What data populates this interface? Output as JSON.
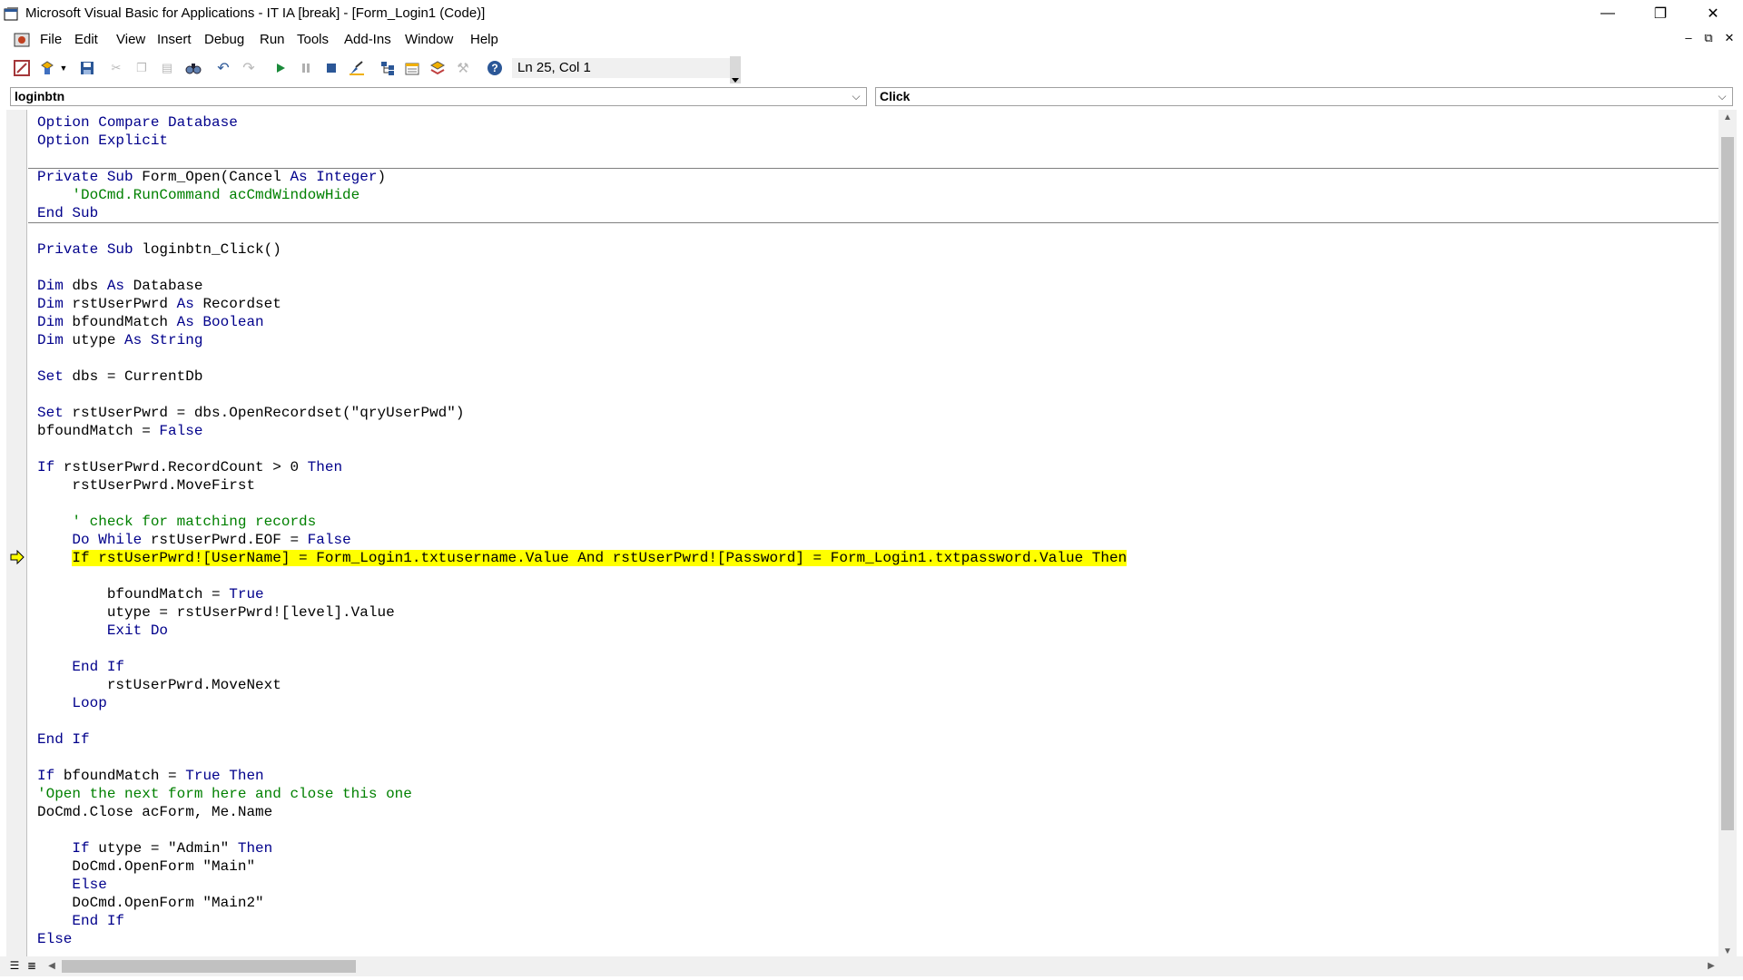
{
  "window": {
    "title": "Microsoft Visual Basic for Applications - IT IA [break] - [Form_Login1 (Code)]",
    "minimize_glyph": "—",
    "restore_glyph": "❐",
    "close_glyph": "✕"
  },
  "menu": {
    "items": [
      {
        "label": "File"
      },
      {
        "label": "Edit"
      },
      {
        "label": "View"
      },
      {
        "label": "Insert"
      },
      {
        "label": "Debug"
      },
      {
        "label": "Run"
      },
      {
        "label": "Tools"
      },
      {
        "label": "Add-Ins"
      },
      {
        "label": "Window"
      },
      {
        "label": "Help"
      }
    ],
    "mdi_min": "–",
    "mdi_restore": "⧉",
    "mdi_close": "✕"
  },
  "toolbar": {
    "status": "Ln 25, Col 1",
    "icons": [
      "view-access-icon",
      "insert-userform-icon",
      "save-icon",
      "cut-icon",
      "copy-icon",
      "paste-icon",
      "find-icon",
      "undo-icon",
      "redo-icon",
      "run-icon",
      "break-icon",
      "reset-icon",
      "design-mode-icon",
      "project-explorer-icon",
      "properties-window-icon",
      "object-browser-icon",
      "toolbox-icon",
      "help-icon"
    ]
  },
  "object_combo": {
    "value": "loginbtn"
  },
  "procedure_combo": {
    "value": "Click"
  },
  "code": {
    "current_line_index": 24,
    "separator_after_lines": [
      2,
      5
    ],
    "lines": [
      [
        [
          "kw",
          "Option Compare Database"
        ]
      ],
      [
        [
          "kw",
          "Option Explicit"
        ]
      ],
      [
        [
          "",
          ""
        ]
      ],
      [
        [
          "kw",
          "Private Sub "
        ],
        [
          "",
          "Form_Open("
        ],
        [
          "",
          "Cancel "
        ],
        [
          "kw",
          "As Integer"
        ],
        [
          "",
          ")"
        ]
      ],
      [
        [
          "",
          "    "
        ],
        [
          "cm",
          "'DoCmd.RunCommand acCmdWindowHide"
        ]
      ],
      [
        [
          "kw",
          "End Sub"
        ]
      ],
      [
        [
          "",
          ""
        ]
      ],
      [
        [
          "kw",
          "Private Sub "
        ],
        [
          "",
          "loginbtn_Click()"
        ]
      ],
      [
        [
          "",
          ""
        ]
      ],
      [
        [
          "kw",
          "Dim "
        ],
        [
          "",
          "dbs "
        ],
        [
          "kw",
          "As "
        ],
        [
          "",
          "Database"
        ]
      ],
      [
        [
          "kw",
          "Dim "
        ],
        [
          "",
          "rstUserPwrd "
        ],
        [
          "kw",
          "As "
        ],
        [
          "",
          "Recordset"
        ]
      ],
      [
        [
          "kw",
          "Dim "
        ],
        [
          "",
          "bfoundMatch "
        ],
        [
          "kw",
          "As Boolean"
        ]
      ],
      [
        [
          "kw",
          "Dim "
        ],
        [
          "",
          "utype "
        ],
        [
          "kw",
          "As String"
        ]
      ],
      [
        [
          "",
          ""
        ]
      ],
      [
        [
          "kw",
          "Set "
        ],
        [
          "",
          "dbs = CurrentDb"
        ]
      ],
      [
        [
          "",
          ""
        ]
      ],
      [
        [
          "kw",
          "Set "
        ],
        [
          "",
          "rstUserPwrd = dbs.OpenRecordset(\"qryUserPwd\")"
        ]
      ],
      [
        [
          "",
          "bfoundMatch = "
        ],
        [
          "kw",
          "False"
        ]
      ],
      [
        [
          "",
          ""
        ]
      ],
      [
        [
          "kw",
          "If "
        ],
        [
          "",
          "rstUserPwrd.RecordCount > 0 "
        ],
        [
          "kw",
          "Then"
        ]
      ],
      [
        [
          "",
          "    rstUserPwrd.MoveFirst"
        ]
      ],
      [
        [
          "",
          ""
        ]
      ],
      [
        [
          "",
          "    "
        ],
        [
          "cm",
          "' check for matching records"
        ]
      ],
      [
        [
          "",
          "    "
        ],
        [
          "kw",
          "Do While "
        ],
        [
          "",
          "rstUserPwrd.EOF = "
        ],
        [
          "kw",
          "False"
        ]
      ],
      [
        [
          "",
          "    "
        ],
        [
          "hl",
          "If rstUserPwrd![UserName] = Form_Login1.txtusername.Value And rstUserPwrd![Password] = Form_Login1.txtpassword.Value Then"
        ]
      ],
      [
        [
          "",
          ""
        ]
      ],
      [
        [
          "",
          "        bfoundMatch = "
        ],
        [
          "kw",
          "True"
        ]
      ],
      [
        [
          "",
          "        utype = rstUserPwrd![level].Value"
        ]
      ],
      [
        [
          "",
          "        "
        ],
        [
          "kw",
          "Exit Do"
        ]
      ],
      [
        [
          "",
          ""
        ]
      ],
      [
        [
          "",
          "    "
        ],
        [
          "kw",
          "End If"
        ]
      ],
      [
        [
          "",
          "        rstUserPwrd.MoveNext"
        ]
      ],
      [
        [
          "",
          "    "
        ],
        [
          "kw",
          "Loop"
        ]
      ],
      [
        [
          "",
          ""
        ]
      ],
      [
        [
          "kw",
          "End If"
        ]
      ],
      [
        [
          "",
          ""
        ]
      ],
      [
        [
          "kw",
          "If "
        ],
        [
          "",
          "bfoundMatch = "
        ],
        [
          "kw",
          "True Then"
        ]
      ],
      [
        [
          "cm",
          "'Open the next form here and close this one"
        ]
      ],
      [
        [
          "",
          "DoCmd.Close acForm, Me.Name"
        ]
      ],
      [
        [
          "",
          ""
        ]
      ],
      [
        [
          "",
          "    "
        ],
        [
          "kw",
          "If "
        ],
        [
          "",
          "utype = \"Admin\" "
        ],
        [
          "kw",
          "Then"
        ]
      ],
      [
        [
          "",
          "    DoCmd.OpenForm \"Main\""
        ]
      ],
      [
        [
          "",
          "    "
        ],
        [
          "kw",
          "Else"
        ]
      ],
      [
        [
          "",
          "    DoCmd.OpenForm \"Main2\""
        ]
      ],
      [
        [
          "",
          "    "
        ],
        [
          "kw",
          "End If"
        ]
      ],
      [
        [
          "kw",
          "Else"
        ]
      ]
    ]
  }
}
